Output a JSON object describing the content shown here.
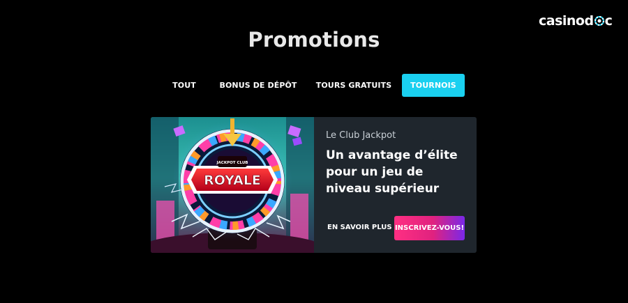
{
  "header": {
    "logo": {
      "text_before": "casinod",
      "chip_icon": "poker-chip-icon",
      "text_after": "c",
      "accent_color": "#1ad0f0"
    }
  },
  "page": {
    "title": "Promotions"
  },
  "tabs": [
    {
      "label": "TOUT",
      "active": false
    },
    {
      "label": "BONUS DE DÉPÔT",
      "active": false
    },
    {
      "label": "TOURS GRATUITS",
      "active": false
    },
    {
      "label": "TOURNOIS",
      "active": true
    }
  ],
  "promotion": {
    "image": {
      "badge_text": "ROYALE",
      "badge_small_text": "JACKPOT CLUB"
    },
    "subtitle": "Le Club Jackpot",
    "headline": "Un avantage d’élite pour un jeu de niveau supérieur",
    "learn_more_label": "EN SAVOIR PLUS",
    "signup_label": "INSCRIVEZ-VOUS!"
  },
  "colors": {
    "background": "#000000",
    "card_background": "#1f262d",
    "active_tab": "#1ad0f0",
    "signup_gradient_start": "#ff2f82",
    "signup_gradient_end": "#7a28e8"
  }
}
